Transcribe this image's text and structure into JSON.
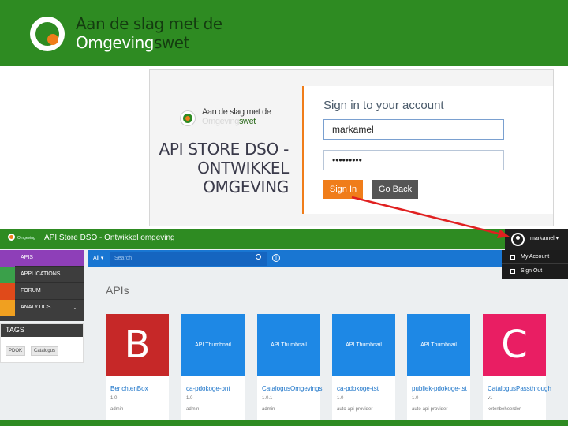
{
  "banner": {
    "title_line1": "Aan de slag met de",
    "title_line2_a": "Omgeving",
    "title_line2_b": "swet"
  },
  "login": {
    "brand_line1": "Aan de slag met de",
    "brand_line2_a": "Omgeving",
    "brand_line2_b": "swet",
    "store_title": "API STORE DSO - ONTWIKKEL OMGEVING",
    "heading": "Sign in to your account",
    "username_value": "markamel",
    "password_value": "•••••••••",
    "signin_label": "Sign In",
    "back_label": "Go Back"
  },
  "store": {
    "header_brand": "Omgeving",
    "header_title": "API Store DSO - Ontwikkel omgeving",
    "username": "markamel ▾",
    "menu": {
      "account": "My Account",
      "signout": "Sign Out"
    },
    "sidebar": [
      {
        "label": "APIS"
      },
      {
        "label": "APPLICATIONS"
      },
      {
        "label": "FORUM"
      },
      {
        "label": "ANALYTICS"
      }
    ],
    "tags_title": "TAGS",
    "tags": [
      "PDOK",
      "Catalogus"
    ],
    "search_filter": "All ▾",
    "search_placeholder": "Search",
    "info_glyph": "i",
    "apis_heading": "APIs",
    "cards": [
      {
        "thumb": "B",
        "name": "BerichtenBox",
        "version": "1.0",
        "owner": "admin"
      },
      {
        "thumb": "API Thumbnail",
        "name": "ca-pdokoge-ont",
        "version": "1.0",
        "owner": "admin"
      },
      {
        "thumb": "API Thumbnail",
        "name": "CatalogusOmgevings",
        "version": "1.0.1",
        "owner": "admin"
      },
      {
        "thumb": "API Thumbnail",
        "name": "ca-pdokoge-tst",
        "version": "1.0",
        "owner": "auto-api-provider"
      },
      {
        "thumb": "API Thumbnail",
        "name": "publiek-pdokoge-tst",
        "version": "1.0",
        "owner": "auto-api-provider"
      },
      {
        "thumb": "C",
        "name": "CatalogusPassthrough",
        "version": "v1",
        "owner": "ketenbeheerder"
      }
    ]
  },
  "colors": {
    "brand_green": "#2e8b22",
    "accent_orange": "#f07d1a",
    "arrow_red": "#e02020",
    "search_blue": "#1976d2"
  }
}
